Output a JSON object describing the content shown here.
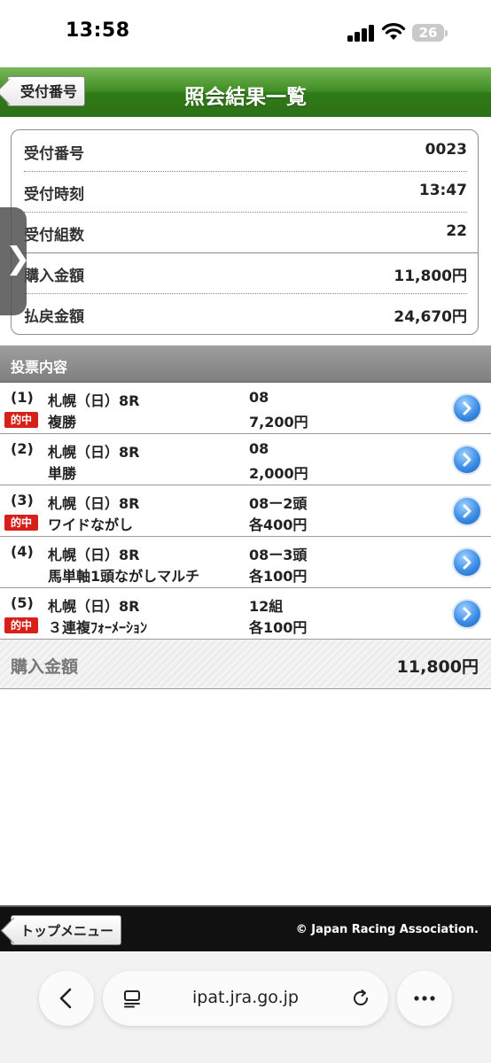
{
  "status_bar": {
    "time": "13:58",
    "battery": "26"
  },
  "header": {
    "back_label": "受付番号",
    "title": "照会結果一覧"
  },
  "summary": [
    {
      "label": "受付番号",
      "value": "0023"
    },
    {
      "label": "受付時刻",
      "value": "13:47"
    },
    {
      "label": "受付組数",
      "value": "22"
    },
    {
      "label": "購入金額",
      "value": "11,800円"
    },
    {
      "label": "払戻金額",
      "value": "24,670円"
    }
  ],
  "section_title": "投票内容",
  "hit_label": "的中",
  "bets": [
    {
      "num": "(1)",
      "race": "札幌（日）8R",
      "type": "複勝",
      "combo": "08",
      "amount": "7,200円",
      "hit": true
    },
    {
      "num": "(2)",
      "race": "札幌（日）8R",
      "type": "単勝",
      "combo": "08",
      "amount": "2,000円",
      "hit": false
    },
    {
      "num": "(3)",
      "race": "札幌（日）8R",
      "type": "ワイドながし",
      "combo": "08ー2頭",
      "amount": "各400円",
      "hit": true
    },
    {
      "num": "(4)",
      "race": "札幌（日）8R",
      "type": "馬単軸1頭ながしマルチ",
      "combo": "08ー3頭",
      "amount": "各100円",
      "hit": false
    },
    {
      "num": "(5)",
      "race": "札幌（日）8R",
      "type": "３連複ﾌｫｰﾒｰｼｮﾝ",
      "combo": "12組",
      "amount": "各100円",
      "hit": true
    }
  ],
  "total": {
    "label": "購入金額",
    "value": "11,800円"
  },
  "footer": {
    "top_menu_label": "トップメニュー",
    "copyright": "© Japan Racing Association."
  },
  "browser": {
    "url": "ipat.jra.go.jp"
  },
  "side_handle_glyph": "❯"
}
